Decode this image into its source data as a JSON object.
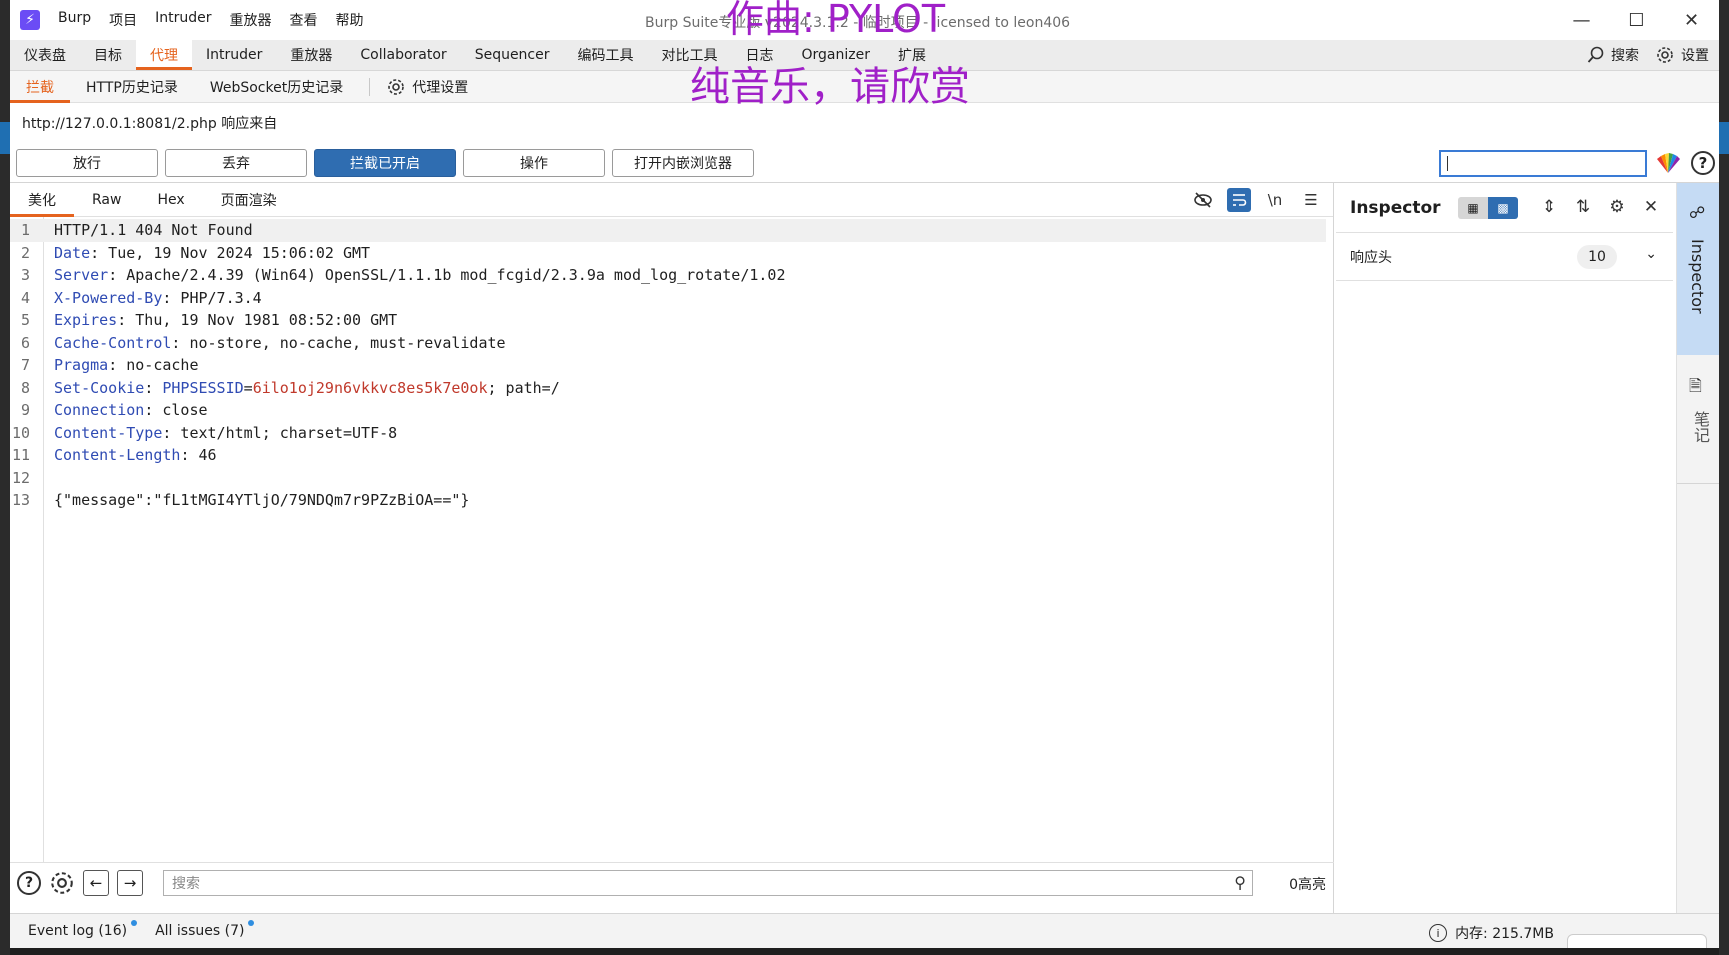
{
  "app": {
    "title": "Burp Suite专业版 v2024.3.1.2 - 临时项目 - licensed to leon406",
    "logo_glyph": "⚡",
    "menus": [
      "Burp",
      "项目",
      "Intruder",
      "重放器",
      "查看",
      "帮助"
    ]
  },
  "overlay": {
    "line1": "作曲: PYLOT",
    "line2": "纯音乐，请欣赏"
  },
  "main_tabs": [
    "仪表盘",
    "目标",
    "代理",
    "Intruder",
    "重放器",
    "Collaborator",
    "Sequencer",
    "编码工具",
    "对比工具",
    "日志",
    "Organizer",
    "扩展"
  ],
  "main_tab_active": "代理",
  "topright": {
    "search_label": "搜索",
    "settings_label": "设置"
  },
  "sub_tabs": [
    "拦截",
    "HTTP历史记录",
    "WebSocket历史记录"
  ],
  "proxy_settings_label": "代理设置",
  "url_line": "http://127.0.0.1:8081/2.php 响应来自",
  "actions": {
    "forward": "放行",
    "drop": "丢弃",
    "intercept": "拦截已开启",
    "action": "操作",
    "browser": "打开内嵌浏览器"
  },
  "editor_tabs": [
    "美化",
    "Raw",
    "Hex",
    "页面渲染"
  ],
  "editor_tools": {
    "newline_label": "\\n"
  },
  "response": {
    "l1": "HTTP/1.1 404 Not Found",
    "l2k": "Date",
    "l2v": ": Tue, 19 Nov 2024 15:06:02 GMT",
    "l3k": "Server",
    "l3v": ": Apache/2.4.39 (Win64) OpenSSL/1.1.1b mod_fcgid/2.3.9a mod_log_rotate/1.02",
    "l4k": "X-Powered-By",
    "l4v": ": PHP/7.3.4",
    "l5k": "Expires",
    "l5v": ": Thu, 19 Nov 1981 08:52:00 GMT",
    "l6k": "Cache-Control",
    "l6v": ": no-store, no-cache, must-revalidate",
    "l7k": "Pragma",
    "l7v": ": no-cache",
    "l8k": "Set-Cookie",
    "l8sep": ": ",
    "l8ck": "PHPSESSID",
    "l8eq": "=",
    "l8cv": "6ilo1oj29n6vkkvc8es5k7e0ok",
    "l8rest": "; path=/",
    "l9k": "Connection",
    "l9v": ": close",
    "l10k": "Content-Type",
    "l10v": ": text/html; charset=UTF-8",
    "l11k": "Content-Length",
    "l11v": ": 46",
    "l13": "{\"message\":\"fL1tMGI4YTljO/79NDQm7r9PZzBiOA==\"}"
  },
  "line_numbers": [
    "1",
    "2",
    "3",
    "4",
    "5",
    "6",
    "7",
    "8",
    "9",
    "10",
    "11",
    "12",
    "13"
  ],
  "bottom": {
    "search_placeholder": "搜索",
    "highlights": "0高亮"
  },
  "inspector": {
    "title": "Inspector",
    "section": "响应头",
    "count": "10"
  },
  "rail": {
    "inspector": "Inspector",
    "notes": "笔记"
  },
  "status": {
    "event_log": "Event log (16)",
    "issues": "All issues (7)",
    "memory": "内存: 215.7MB"
  }
}
